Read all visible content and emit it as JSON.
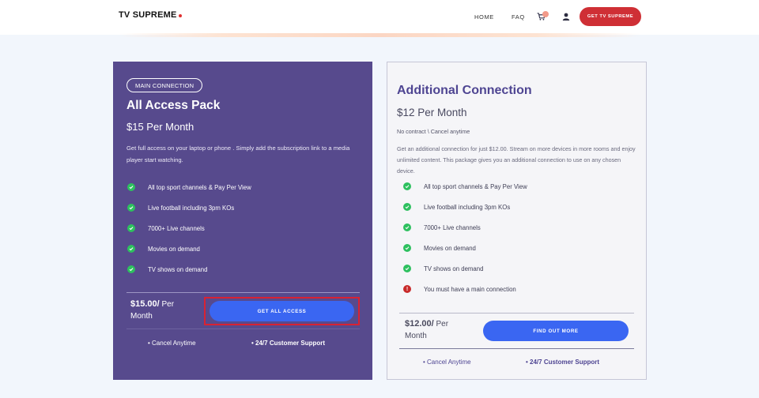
{
  "header": {
    "logo": "TV SUPREME",
    "nav": {
      "home": "HOME",
      "faq": "FAQ"
    },
    "cta": "GET TV SUPREME",
    "icons": {
      "cart": "cart-icon",
      "user": "user-icon"
    }
  },
  "main_card": {
    "tag": "MAIN CONNECTION",
    "title": "All Access Pack",
    "price_title": "$15 Per Month",
    "description": "Get full access on your laptop or phone . Simply add the subscription link to a media player start watching.",
    "features": [
      "All top sport channels & Pay Per View",
      "Live football including 3pm KOs",
      "7000+ Live channels",
      "Movies on demand",
      "TV shows on demand"
    ],
    "price_amount": "$15.00/",
    "price_per": "Per",
    "price_month": "Month",
    "button": "GET ALL ACCESS",
    "footer": [
      "• Cancel Anytime",
      "• 24/7 Customer Support"
    ]
  },
  "add_card": {
    "title": "Additional Connection",
    "price_title": "$12 Per Month",
    "contract": "No contract \\ Cancel anytime",
    "description": "Get an additional connection for just $12.00. Stream on more devices in more rooms and enjoy unlimited content. This package gives you an additional connection to use on any chosen device.",
    "features": [
      "All top sport channels & Pay Per View",
      "Live football including 3pm KOs",
      "7000+ Live channels",
      "Movies on demand",
      "TV shows on demand"
    ],
    "warning": "You must have a main connection",
    "price_amount": "$12.00/",
    "price_per": "Per",
    "price_month": "Month",
    "button": "FIND OUT MORE",
    "footer": [
      "• Cancel Anytime",
      "• 24/7 Customer Support"
    ]
  },
  "colors": {
    "main_card_bg": "#574a8d",
    "accent_red": "#cf2f35",
    "button_blue": "#3a66f2",
    "check_green": "#2ec05f",
    "warning_red": "#c82a2a"
  }
}
